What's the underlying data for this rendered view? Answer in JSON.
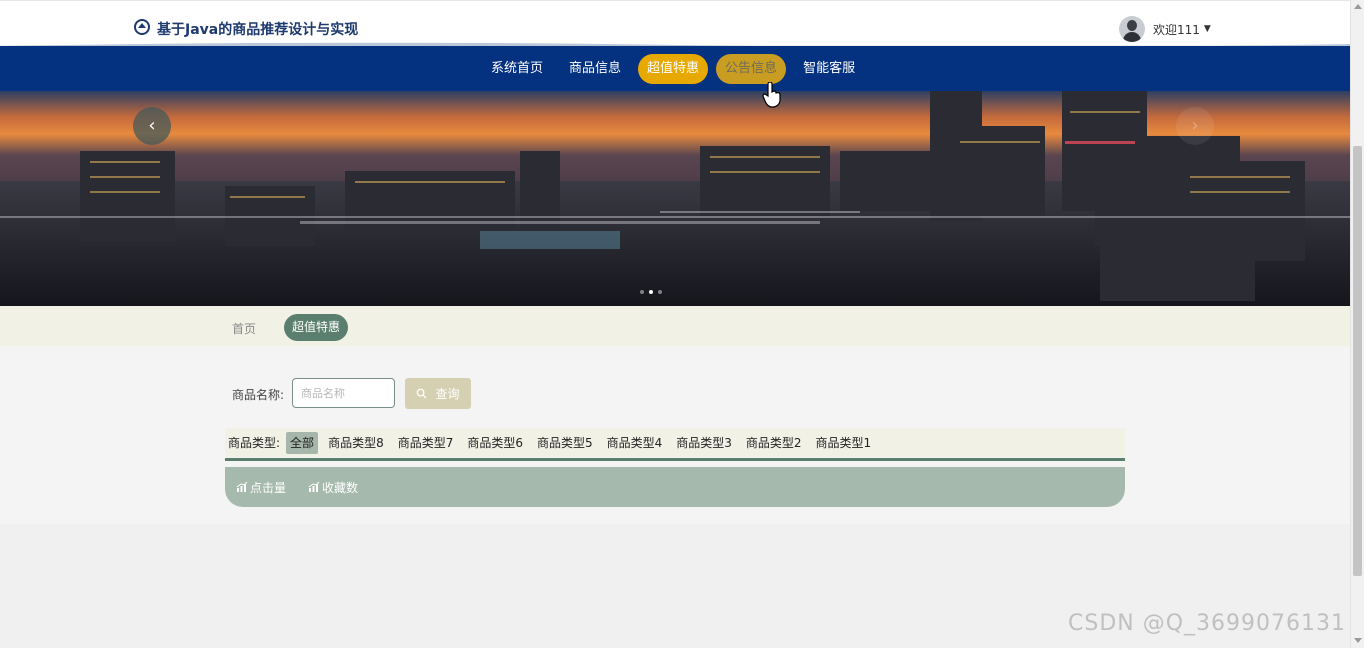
{
  "header": {
    "site_title": "基于Java的商品推荐设计与实现",
    "welcome_text": "欢迎111",
    "caret": "▼"
  },
  "nav": {
    "items": [
      {
        "label": "系统首页",
        "state": "normal"
      },
      {
        "label": "商品信息",
        "state": "normal"
      },
      {
        "label": "超值特惠",
        "state": "active"
      },
      {
        "label": "公告信息",
        "state": "hover"
      },
      {
        "label": "智能客服",
        "state": "normal"
      }
    ]
  },
  "banner": {
    "prev_glyph": "‹",
    "next_glyph": "›",
    "slide_count": 3,
    "active_slide": 2
  },
  "breadcrumb": {
    "home": "首页",
    "current": "超值特惠"
  },
  "search": {
    "label": "商品名称:",
    "placeholder": "商品名称",
    "value": "",
    "button": "查询"
  },
  "types": {
    "label": "商品类型:",
    "items": [
      "全部",
      "商品类型8",
      "商品类型7",
      "商品类型6",
      "商品类型5",
      "商品类型4",
      "商品类型3",
      "商品类型2",
      "商品类型1"
    ],
    "selected": "全部"
  },
  "sort": {
    "items": [
      "点击量",
      "收藏数"
    ]
  },
  "watermark": "CSDN @Q_3699076131",
  "colors": {
    "nav_bg": "#053181",
    "nav_active": "#e7a800",
    "accent_green": "#5b7f6f",
    "sort_bar": "#a6b9ad",
    "search_btn": "#d6d0b3"
  }
}
